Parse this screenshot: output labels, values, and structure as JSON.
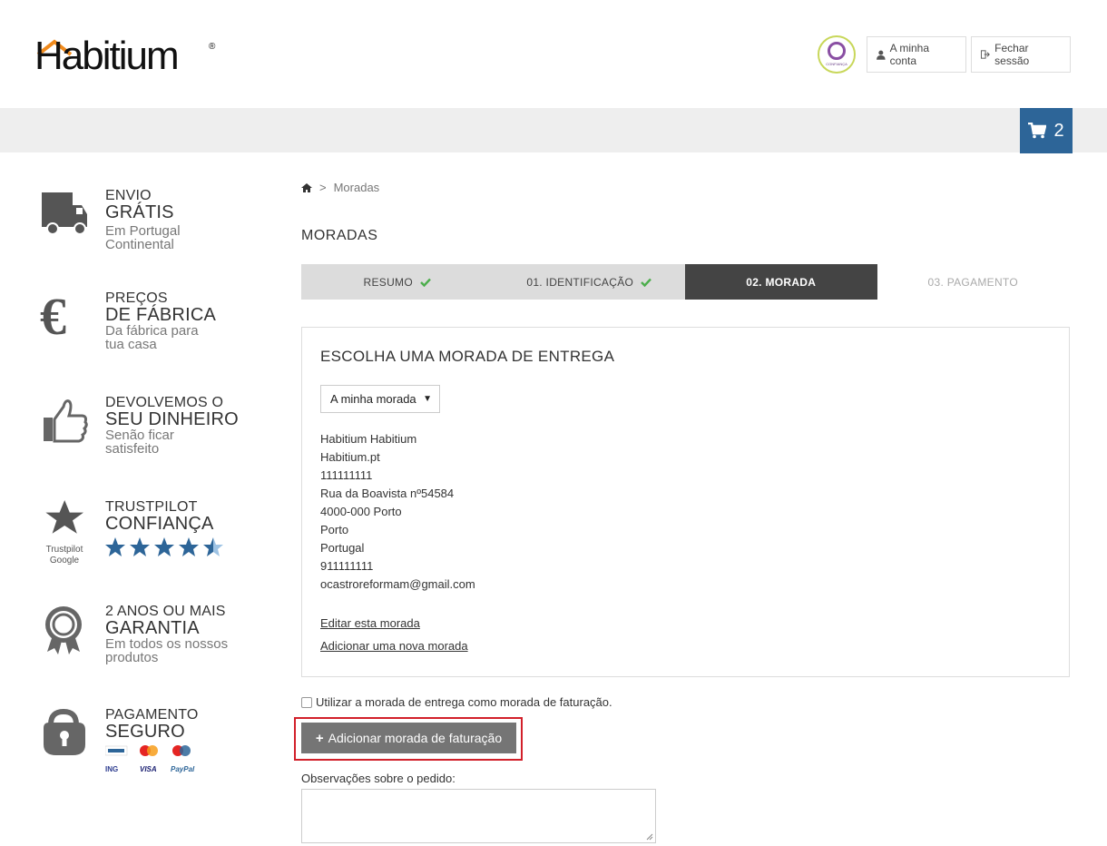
{
  "header": {
    "logo_text": "Habitium",
    "logo_reg": "®",
    "trust_badge_text": "CONFIANÇA",
    "account_label": "A minha conta",
    "logout_label": "Fechar sessão",
    "cart_count": "2",
    "accent_color": "#2d6598",
    "logo_accent": "#f08a1c"
  },
  "sidebar": [
    {
      "icon": "truck-icon",
      "line1": "ENVIO",
      "line2": "GRÁTIS",
      "line3": "Em Portugal",
      "line4": "Continental"
    },
    {
      "icon": "euro-icon",
      "line1": "PREÇOS",
      "line2": "DE FÁBRICA",
      "line3": "Da fábrica para",
      "line4": "tua casa"
    },
    {
      "icon": "thumbs-up-icon",
      "line1": "DEVOLVEMOS O",
      "line2": "SEU DINHEIRO",
      "line3": "Senão ficar",
      "line4": "satisfeito"
    },
    {
      "icon": "star-icon",
      "line1": "TRUSTPILOT",
      "line2": "CONFIANÇA",
      "sub1": "Trustpilot",
      "sub2": "Google",
      "rating": 4.5
    },
    {
      "icon": "medal-icon",
      "line1": "2 ANOS OU MAIS",
      "line2": "GARANTIA",
      "line3": "Em todos os nossos",
      "line4": "produtos"
    },
    {
      "icon": "padlock-icon",
      "line1": "PAGAMENTO",
      "line2": "SEGURO",
      "pay1": "ING",
      "pay2": "VISA",
      "pay3": "PayPal"
    }
  ],
  "breadcrumb": {
    "current": "Moradas",
    "separator": ">"
  },
  "page_title": "MORADAS",
  "steps": [
    {
      "label": "RESUMO",
      "state": "done"
    },
    {
      "label": "01. IDENTIFICAÇÃO",
      "state": "done"
    },
    {
      "label": "02. MORADA",
      "state": "active"
    },
    {
      "label": "03. PAGAMENTO",
      "state": "future"
    }
  ],
  "address": {
    "title": "ESCOLHA UMA MORADA DE ENTREGA",
    "select_value": "A minha morada",
    "lines": [
      "Habitium Habitium",
      "Habitium.pt",
      "111111111",
      "Rua da Boavista nº54584",
      "4000-000 Porto",
      "Porto",
      "Portugal",
      "911111111",
      "ocastroreformam@gmail.com"
    ],
    "edit_link": "Editar esta morada",
    "add_link": "Adicionar uma nova morada"
  },
  "billing": {
    "checkbox_label": "Utilizar a morada de entrega como morada de faturação.",
    "add_button": "Adicionar morada de faturação",
    "add_button_icon": "plus-icon"
  },
  "notes": {
    "label": "Observações sobre o pedido:",
    "value": ""
  }
}
